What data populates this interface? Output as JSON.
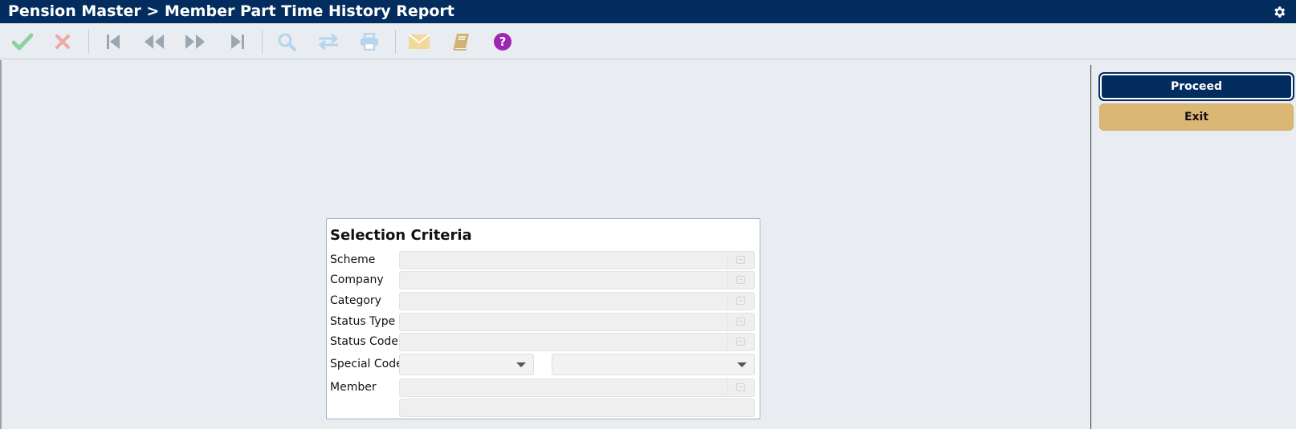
{
  "header": {
    "title": "Pension Master > Member Part Time History Report",
    "settings_icon": "gear-icon"
  },
  "toolbar": {
    "buttons": [
      {
        "name": "accept",
        "icon": "check-icon",
        "color": "#8fd19e"
      },
      {
        "name": "cancel",
        "icon": "close-icon",
        "color": "#f0a7a7"
      },
      {
        "name": "first",
        "icon": "first-record-icon",
        "color": "#9aa6b2"
      },
      {
        "name": "previous",
        "icon": "previous-record-icon",
        "color": "#9aa6b2"
      },
      {
        "name": "next",
        "icon": "next-record-icon",
        "color": "#9aa6b2"
      },
      {
        "name": "last",
        "icon": "last-record-icon",
        "color": "#9aa6b2"
      },
      {
        "name": "search",
        "icon": "search-icon",
        "color": "#b5d5ee"
      },
      {
        "name": "transfer",
        "icon": "swap-icon",
        "color": "#b5d5ee"
      },
      {
        "name": "print",
        "icon": "print-icon",
        "color": "#b5d5ee"
      },
      {
        "name": "email",
        "icon": "envelope-icon",
        "color": "#f2d89a"
      },
      {
        "name": "notes",
        "icon": "notebook-icon",
        "color": "#d2b274"
      },
      {
        "name": "help",
        "icon": "help-icon",
        "color": "#9c27b0"
      }
    ]
  },
  "actions": {
    "proceed_label": "Proceed",
    "exit_label": "Exit"
  },
  "selection": {
    "title": "Selection Criteria",
    "scheme_label": "Scheme",
    "company_label": "Company",
    "category_label": "Category",
    "status_type_label": "Status Type",
    "status_code_label": "Status Code",
    "special_code_label": "Special Code",
    "member_label": "Member",
    "scheme_value": "",
    "company_value": "",
    "category_value": "",
    "status_type_value": "",
    "status_code_value": "",
    "special_code_value": "",
    "special_code_secondary_value": "",
    "member_value": "",
    "member_name_value": ""
  },
  "colors": {
    "title_bar": "#022d5e",
    "proceed_button": "#022d5e",
    "exit_button": "#dbb776",
    "background": "#e9edf1"
  }
}
